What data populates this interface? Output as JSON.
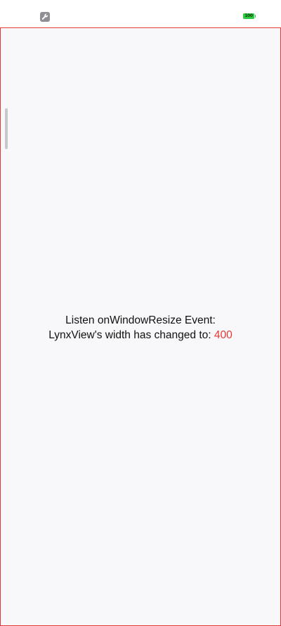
{
  "status_bar": {
    "left_icon": "wrench-icon",
    "battery_icon": "battery-icon",
    "battery_level": "100",
    "battery_color": "#2ecc40"
  },
  "lynx_view": {
    "border_color": "#e53935",
    "event_title": "Listen onWindowResize Event:",
    "width_message": "LynxView's width has changed to: ",
    "width_value": "400",
    "value_color": "#e53935"
  }
}
